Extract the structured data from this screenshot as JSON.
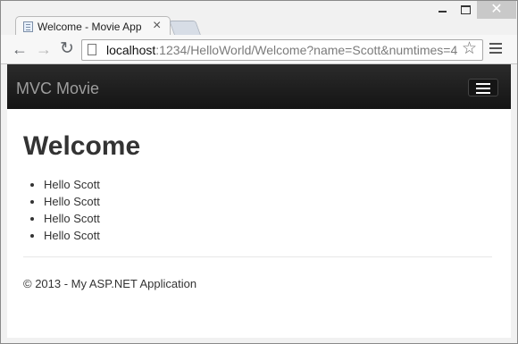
{
  "browser": {
    "tab_title": "Welcome - Movie App",
    "tab_close": "×",
    "url_host": "localhost",
    "url_rest": ":1234/HelloWorld/Welcome?name=Scott&numtimes=4",
    "window_close": "✕"
  },
  "navbar": {
    "brand": "MVC Movie"
  },
  "page": {
    "heading": "Welcome",
    "greetings": [
      "Hello Scott",
      "Hello Scott",
      "Hello Scott",
      "Hello Scott"
    ],
    "footer": "© 2013 - My ASP.NET Application"
  }
}
